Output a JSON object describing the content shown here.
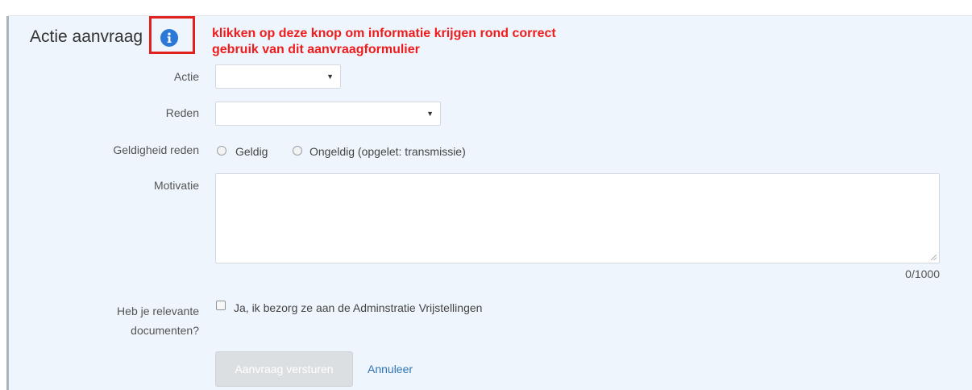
{
  "header": {
    "title": "Actie aanvraag",
    "info_icon": "info-icon",
    "annotation_line1": "klikken op deze knop om informatie krijgen rond correct",
    "annotation_line2": "gebruik van dit aanvraagformulier"
  },
  "form": {
    "actie": {
      "label": "Actie",
      "value": ""
    },
    "reden": {
      "label": "Reden",
      "value": ""
    },
    "geldigheid": {
      "label": "Geldigheid reden",
      "options": [
        "Geldig",
        "Ongeldig (opgelet: transmissie)"
      ]
    },
    "motivatie": {
      "label": "Motivatie",
      "value": "",
      "counter": "0/1000"
    },
    "documenten": {
      "label_line1": "Heb je relevante",
      "label_line2": "documenten?",
      "checkbox_label": "Ja, ik bezorg ze aan de Adminstratie Vrijstellingen"
    }
  },
  "actions": {
    "submit_label": "Aanvraag versturen",
    "cancel_label": "Annuleer"
  },
  "colors": {
    "panel_bg": "#eef5fc",
    "annotation": "#ee1c1c",
    "info_icon": "#2b78d6",
    "link": "#2f75b5"
  }
}
